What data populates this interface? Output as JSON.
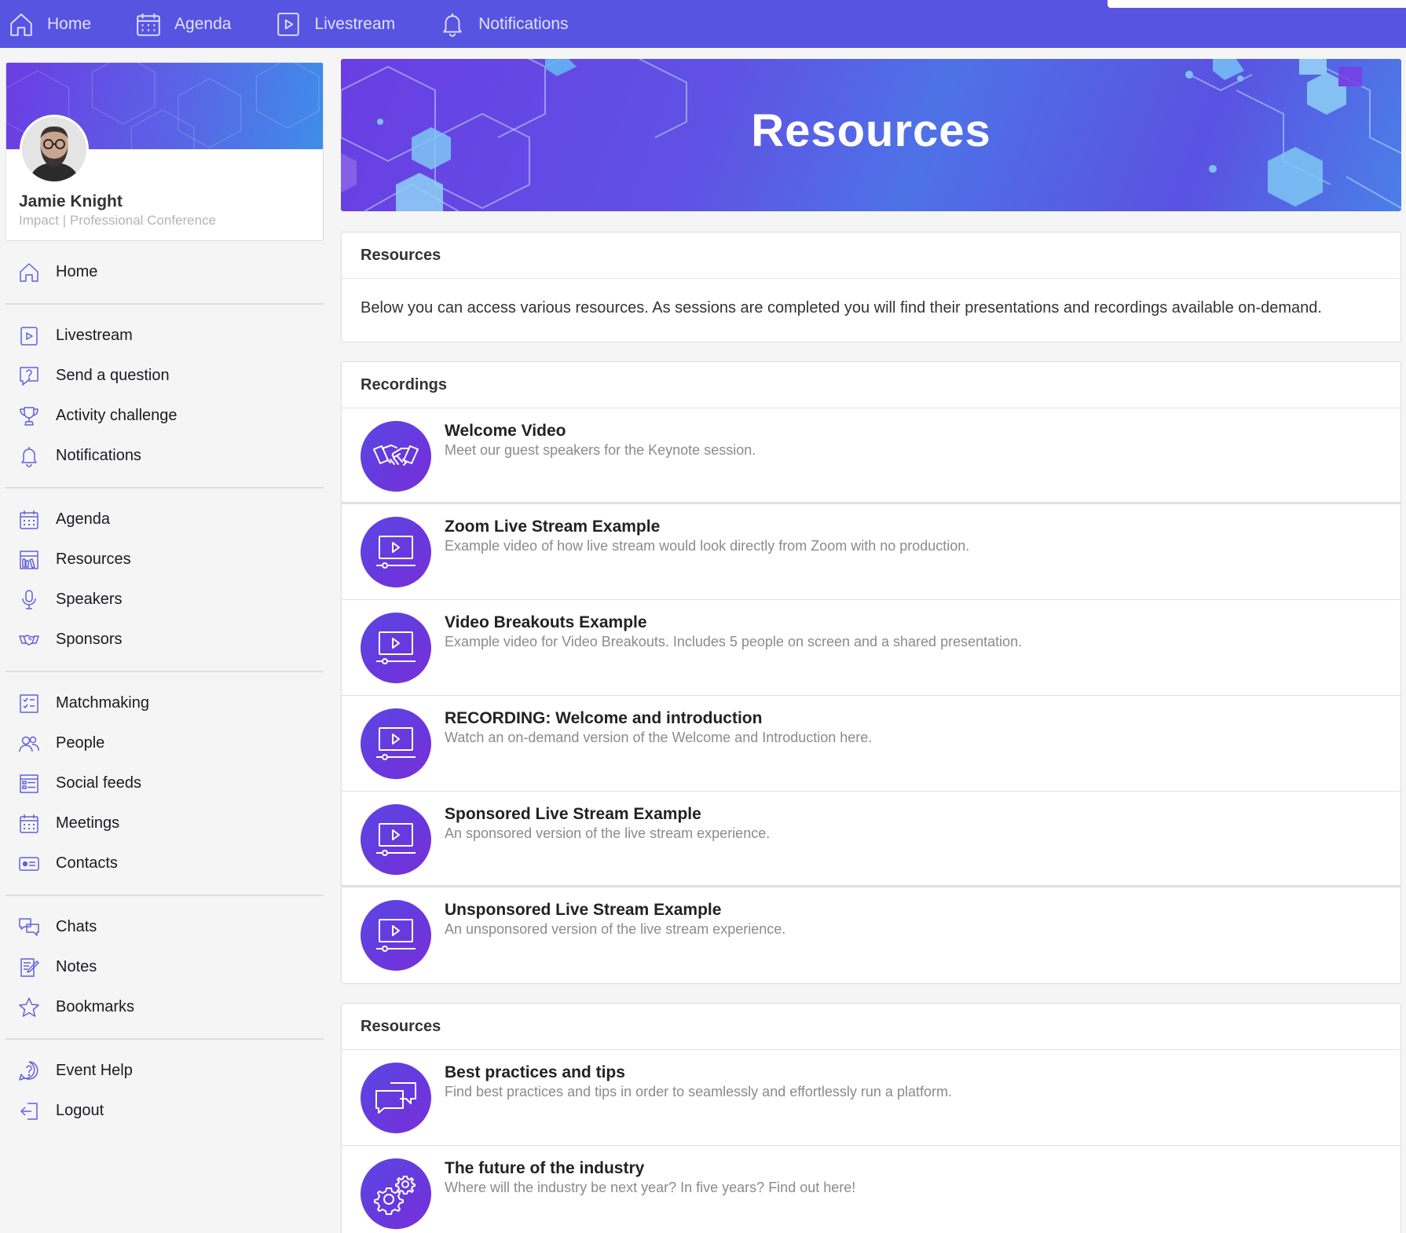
{
  "topnav": [
    {
      "label": "Home",
      "icon": "home-icon"
    },
    {
      "label": "Agenda",
      "icon": "calendar-icon"
    },
    {
      "label": "Livestream",
      "icon": "play-icon"
    },
    {
      "label": "Notifications",
      "icon": "bell-icon"
    }
  ],
  "profile": {
    "name": "Jamie Knight",
    "event": "Impact | Professional Conference"
  },
  "sidebar": {
    "groups": [
      [
        {
          "label": "Home",
          "icon": "home-icon"
        }
      ],
      [
        {
          "label": "Livestream",
          "icon": "play-icon"
        },
        {
          "label": "Send a question",
          "icon": "question-bubble-icon"
        },
        {
          "label": "Activity challenge",
          "icon": "trophy-icon"
        },
        {
          "label": "Notifications",
          "icon": "bell-icon"
        }
      ],
      [
        {
          "label": "Agenda",
          "icon": "calendar-icon"
        },
        {
          "label": "Resources",
          "icon": "library-icon"
        },
        {
          "label": "Speakers",
          "icon": "microphone-icon"
        },
        {
          "label": "Sponsors",
          "icon": "handshake-icon"
        }
      ],
      [
        {
          "label": "Matchmaking",
          "icon": "checklist-icon"
        },
        {
          "label": "People",
          "icon": "people-icon"
        },
        {
          "label": "Social feeds",
          "icon": "feed-icon"
        },
        {
          "label": "Meetings",
          "icon": "calendar-icon"
        },
        {
          "label": "Contacts",
          "icon": "contact-card-icon"
        }
      ],
      [
        {
          "label": "Chats",
          "icon": "chat-icon"
        },
        {
          "label": "Notes",
          "icon": "notes-icon"
        },
        {
          "label": "Bookmarks",
          "icon": "star-icon"
        }
      ],
      [
        {
          "label": "Event Help",
          "icon": "help-icon"
        },
        {
          "label": "Logout",
          "icon": "logout-icon"
        }
      ]
    ]
  },
  "hero": {
    "title": "Resources"
  },
  "intro": {
    "title": "Resources",
    "text": "Below you can access various resources. As sessions are completed you will find their presentations and recordings available on-demand."
  },
  "recordings": {
    "title": "Recordings",
    "items": [
      {
        "title": "Welcome Video",
        "desc": "Meet our guest speakers for the Keynote session.",
        "icon": "handshake-icon"
      },
      {
        "title": "Zoom Live Stream Example",
        "desc": "Example video of how live stream would look directly from Zoom with no production.",
        "icon": "video-player-icon"
      },
      {
        "title": "Video Breakouts Example",
        "desc": "Example video for Video Breakouts. Includes 5 people on screen and a shared presentation.",
        "icon": "video-player-icon"
      },
      {
        "title": "RECORDING: Welcome and introduction",
        "desc": "Watch an on-demand version of the Welcome and Introduction here.",
        "icon": "video-player-icon"
      },
      {
        "title": "Sponsored Live Stream Example",
        "desc": "An sponsored version of the live stream experience.",
        "icon": "video-player-icon"
      },
      {
        "title": "Unsponsored Live Stream Example",
        "desc": "An unsponsored version of the live stream experience.",
        "icon": "video-player-icon"
      }
    ]
  },
  "resources": {
    "title": "Resources",
    "items": [
      {
        "title": "Best practices and tips",
        "desc": "Find best practices and tips in order to seamlessly and effortlessly run a platform.",
        "icon": "chat-bubbles-icon"
      },
      {
        "title": "The future of the industry",
        "desc": "Where will the industry be next year? In five years? Find out here!",
        "icon": "gears-icon"
      }
    ]
  },
  "colors": {
    "topbar": "#5654e0",
    "accent": "#5a4fe3",
    "icon_stroke": "#6260db"
  }
}
